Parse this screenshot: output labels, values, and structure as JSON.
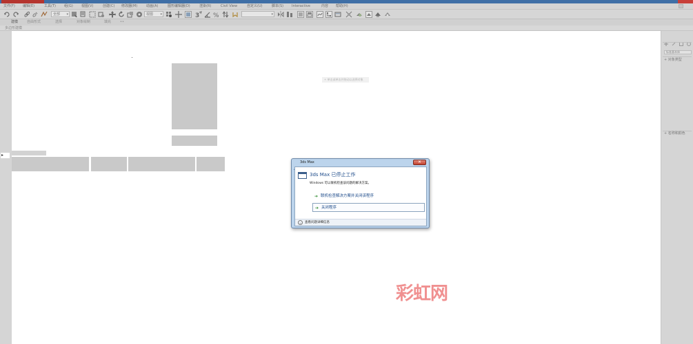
{
  "titlebar": {
    "colors": {
      "bar": "#3f6fa6",
      "logo": "#b5352f",
      "close": "#c8403a"
    }
  },
  "menubar": {
    "items": [
      {
        "label": "文件(F)"
      },
      {
        "label": "编辑(E)"
      },
      {
        "label": "工具(T)"
      },
      {
        "label": "组(G)"
      },
      {
        "label": "视图(V)"
      },
      {
        "label": "创建(C)"
      },
      {
        "label": "修改器(M)"
      },
      {
        "label": "动画(A)"
      },
      {
        "label": "图形编辑器(D)"
      },
      {
        "label": "渲染(R)"
      },
      {
        "label": "Civil View"
      },
      {
        "label": "自定义(U)"
      },
      {
        "label": "脚本(S)"
      },
      {
        "label": "Interactive"
      },
      {
        "label": "内容"
      },
      {
        "label": "帮助(H)"
      }
    ]
  },
  "toolbar": {
    "selection_filter": "全部",
    "reference_coord": "视图",
    "named_selection": "",
    "icons": [
      "undo-icon",
      "redo-icon",
      "link-icon",
      "unlink-icon",
      "bind-spacewarp-icon",
      "select-object-icon",
      "select-by-name-icon",
      "region-select-icon",
      "window-crossing-icon",
      "move-icon",
      "rotate-icon",
      "scale-icon",
      "select-place-icon",
      "pivot-icon",
      "select-manipulate-icon",
      "keyboard-shortcut-icon",
      "snap-3d-icon",
      "angle-snap-icon",
      "percent-snap-icon",
      "spinner-snap-icon",
      "edit-named-sets-icon",
      "mirror-icon",
      "align-icon",
      "layer-explorer-icon",
      "toggle-ribbon-icon",
      "curve-editor-icon",
      "schematic-view-icon",
      "material-editor-icon",
      "render-setup-icon",
      "rendered-frame-icon",
      "render-icon",
      "render-iterative-icon"
    ]
  },
  "ribbon": {
    "tabs": [
      {
        "label": "建模",
        "active": true
      },
      {
        "label": "自由形式",
        "active": false
      },
      {
        "label": "选择",
        "active": false
      },
      {
        "label": "对象绘制",
        "active": false
      },
      {
        "label": "填充",
        "active": false
      },
      {
        "label": "••",
        "active": false
      }
    ],
    "sub_label": "多边形建模"
  },
  "leftstrip": {
    "toggle_label": "▸"
  },
  "command_panel": {
    "dropdown": "标准基本体",
    "rollouts": [
      {
        "label": "+ 对象类型"
      },
      {
        "label": "+ 名称和颜色"
      }
    ]
  },
  "viewport": {
    "status_prompt": "+    单击或单击并拖动以选择对象"
  },
  "dialog": {
    "title": "3ds Max",
    "close_label": "✕",
    "heading": "3ds Max 已停止工作",
    "description": "Windows 可以联机检查该问题的解决方案。",
    "option_online": "联机检查解决方案并关闭该程序",
    "option_close": "关闭程序",
    "footer": "查看问题详细信息"
  },
  "watermark": {
    "text": "彩虹网",
    "color": "#f09090"
  }
}
